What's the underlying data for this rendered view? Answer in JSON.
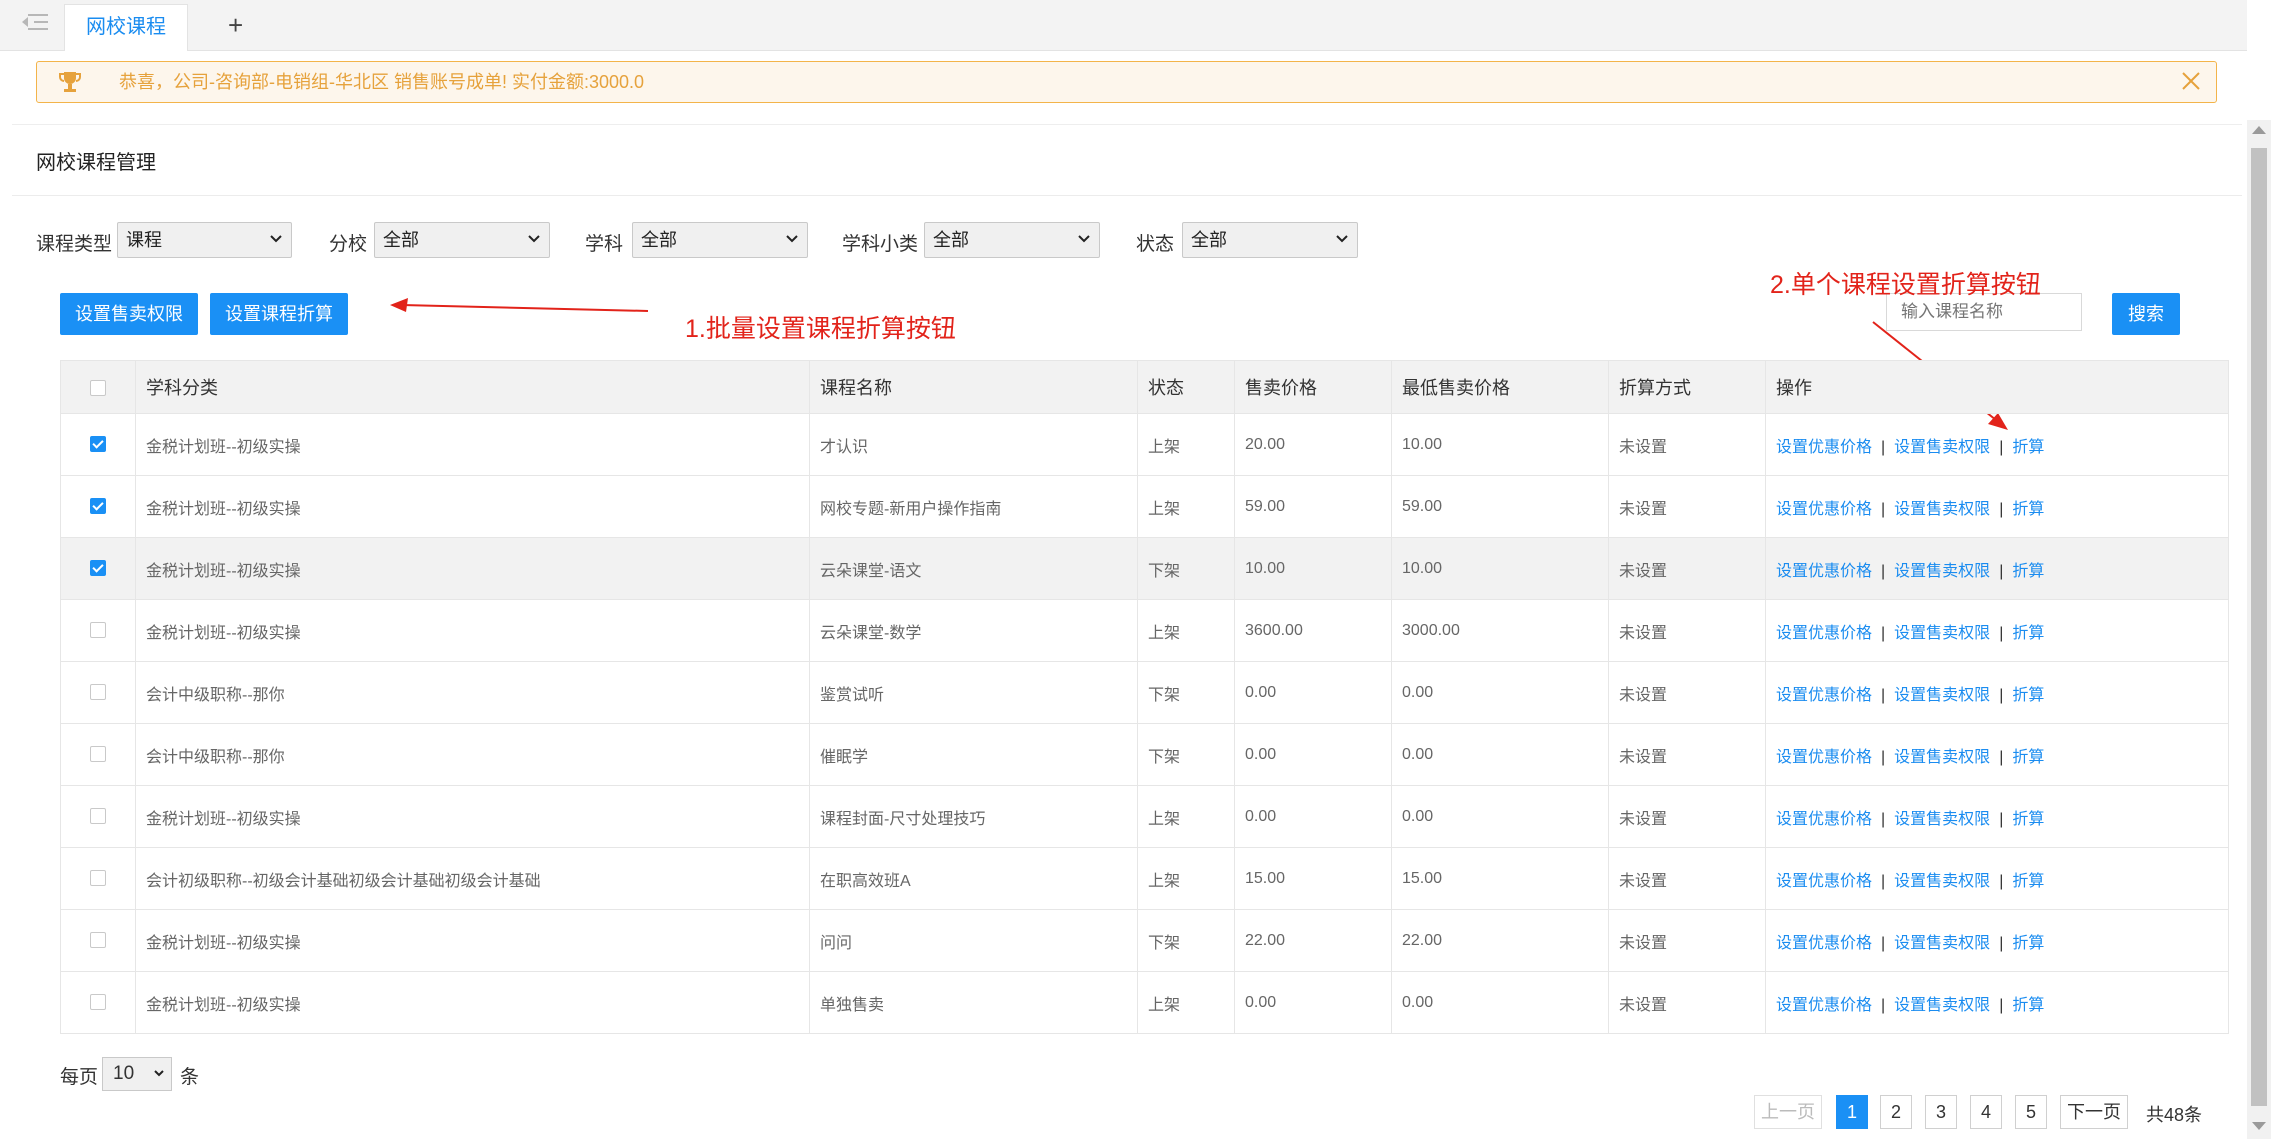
{
  "tabs": {
    "active_label": "网校课程",
    "add_label": "+"
  },
  "notice": {
    "message": "恭喜，公司-咨询部-电销组-华北区  销售账号成单!   实付金额:3000.0"
  },
  "page_title": "网校课程管理",
  "filters": [
    {
      "label": "课程类型",
      "value": "课程"
    },
    {
      "label": "分校",
      "value": "全部"
    },
    {
      "label": "学科",
      "value": "全部"
    },
    {
      "label": "学科小类",
      "value": "全部"
    },
    {
      "label": "状态",
      "value": "全部"
    }
  ],
  "toolbar": {
    "set_sale_permission": "设置售卖权限",
    "set_course_discount": "设置课程折算",
    "search_placeholder": "输入课程名称",
    "search_button": "搜索"
  },
  "annotations": {
    "batch": "1.批量设置课程折算按钮",
    "single": "2.单个课程设置折算按钮"
  },
  "table": {
    "headers": [
      "学科分类",
      "课程名称",
      "状态",
      "售卖价格",
      "最低售卖价格",
      "折算方式",
      "操作"
    ],
    "rows": [
      {
        "checked": true,
        "category": "金税计划班--初级实操",
        "name": "才认识",
        "status": "上架",
        "price": "20.00",
        "min_price": "10.00",
        "method": "未设置"
      },
      {
        "checked": true,
        "category": "金税计划班--初级实操",
        "name": "网校专题-新用户操作指南",
        "status": "上架",
        "price": "59.00",
        "min_price": "59.00",
        "method": "未设置"
      },
      {
        "checked": true,
        "category": "金税计划班--初级实操",
        "name": "云朵课堂-语文",
        "status": "下架",
        "price": "10.00",
        "min_price": "10.00",
        "method": "未设置"
      },
      {
        "checked": false,
        "category": "金税计划班--初级实操",
        "name": "云朵课堂-数学",
        "status": "上架",
        "price": "3600.00",
        "min_price": "3000.00",
        "method": "未设置"
      },
      {
        "checked": false,
        "category": "会计中级职称--那你",
        "name": "鉴赏试听",
        "status": "下架",
        "price": "0.00",
        "min_price": "0.00",
        "method": "未设置"
      },
      {
        "checked": false,
        "category": "会计中级职称--那你",
        "name": "催眠学",
        "status": "下架",
        "price": "0.00",
        "min_price": "0.00",
        "method": "未设置"
      },
      {
        "checked": false,
        "category": "金税计划班--初级实操",
        "name": "课程封面-尺寸处理技巧",
        "status": "上架",
        "price": "0.00",
        "min_price": "0.00",
        "method": "未设置"
      },
      {
        "checked": false,
        "category": "会计初级职称--初级会计基础初级会计基础初级会计基础",
        "name": "在职高效班A",
        "status": "上架",
        "price": "15.00",
        "min_price": "15.00",
        "method": "未设置"
      },
      {
        "checked": false,
        "category": "金税计划班--初级实操",
        "name": "问问",
        "status": "下架",
        "price": "22.00",
        "min_price": "22.00",
        "method": "未设置"
      },
      {
        "checked": false,
        "category": "金税计划班--初级实操",
        "name": "单独售卖",
        "status": "上架",
        "price": "0.00",
        "min_price": "0.00",
        "method": "未设置"
      }
    ],
    "actions": [
      "设置优惠价格",
      "设置售卖权限",
      "折算"
    ],
    "action_separator": "|"
  },
  "footer": {
    "per_page_prefix": "每页",
    "per_page_value": "10",
    "per_page_suffix": "条",
    "prev": "上一页",
    "pages": [
      "1",
      "2",
      "3",
      "4",
      "5"
    ],
    "current_page": "1",
    "next": "下一页",
    "total": "共48条"
  },
  "colors": {
    "primary": "#1a90f5",
    "link": "#1a8cf0",
    "notice_text": "#e6a23c",
    "annotation": "#e2231a"
  },
  "icons": [
    "menu-fold-icon",
    "trophy-icon",
    "close-icon",
    "chevron-down-icon"
  ]
}
